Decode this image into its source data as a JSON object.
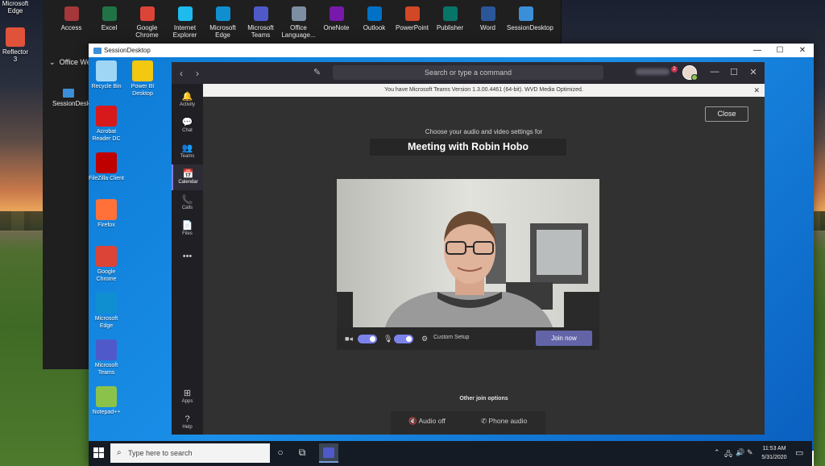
{
  "outer_desktop": {
    "icons": [
      {
        "label": "Microsoft Edge",
        "icon": "edge-icon"
      },
      {
        "label": "Reflector 3",
        "icon": "reflector-icon"
      }
    ]
  },
  "launcher": {
    "apps": [
      {
        "label": "Access",
        "icon": "access-icon",
        "color": "#a4373a"
      },
      {
        "label": "Excel",
        "icon": "excel-icon",
        "color": "#217346"
      },
      {
        "label": "Google Chrome",
        "icon": "chrome-icon",
        "color": "#db4437"
      },
      {
        "label": "Internet Explorer",
        "icon": "ie-icon",
        "color": "#1ebbee"
      },
      {
        "label": "Microsoft Edge",
        "icon": "edge-icon",
        "color": "#0f8fd0"
      },
      {
        "label": "Microsoft Teams",
        "icon": "teams-icon",
        "color": "#5059c9"
      },
      {
        "label": "Office Language...",
        "icon": "office-language-icon",
        "color": "#7d8ea3"
      },
      {
        "label": "OneNote",
        "icon": "onenote-icon",
        "color": "#7719aa"
      },
      {
        "label": "Outlook",
        "icon": "outlook-icon",
        "color": "#0072c6"
      },
      {
        "label": "PowerPoint",
        "icon": "powerpoint-icon",
        "color": "#d24726"
      },
      {
        "label": "Publisher",
        "icon": "publisher-icon",
        "color": "#077568"
      },
      {
        "label": "Word",
        "icon": "word-icon",
        "color": "#2b579a"
      },
      {
        "label": "SessionDesktop",
        "icon": "session-desktop-icon",
        "color": "#3b8fd9"
      }
    ],
    "group_label": "Office We",
    "session_label": "SessionDesktop"
  },
  "session_window": {
    "title": "SessionDesktop",
    "controls": {
      "minimize": "—",
      "maximize": "☐",
      "close": "✕"
    }
  },
  "session_desktop": {
    "icons": [
      {
        "label": "Recycle Bin",
        "icon": "recycle-bin-icon",
        "color": "#9fd6f5"
      },
      {
        "label": "Power BI Desktop",
        "icon": "power-bi-icon",
        "color": "#f2c811"
      },
      {
        "label": "Acrobat Reader DC",
        "icon": "acrobat-icon",
        "color": "#d7191c"
      },
      {
        "label": "FileZilla Client",
        "icon": "filezilla-icon",
        "color": "#bf0000"
      },
      {
        "label": "Firefox",
        "icon": "firefox-icon",
        "color": "#ff7139"
      },
      {
        "label": "Google Chrome",
        "icon": "chrome-icon",
        "color": "#db4437"
      },
      {
        "label": "Microsoft Edge",
        "icon": "edge-icon",
        "color": "#0f8fd0"
      },
      {
        "label": "Microsoft Teams",
        "icon": "teams-icon",
        "color": "#5059c9"
      },
      {
        "label": "Notepad++",
        "icon": "notepadpp-icon",
        "color": "#8bc34a"
      }
    ]
  },
  "teams": {
    "search_placeholder": "Search or type a command",
    "notification_count": "2",
    "rail": [
      {
        "label": "Activity",
        "glyph": "🔔",
        "icon": "activity-icon",
        "active": false
      },
      {
        "label": "Chat",
        "glyph": "💬",
        "icon": "chat-icon",
        "active": false
      },
      {
        "label": "Teams",
        "glyph": "👥",
        "icon": "teams-icon",
        "active": false
      },
      {
        "label": "Calendar",
        "glyph": "📅",
        "icon": "calendar-icon",
        "active": true
      },
      {
        "label": "Calls",
        "glyph": "📞",
        "icon": "calls-icon",
        "active": false
      },
      {
        "label": "Files",
        "glyph": "📄",
        "icon": "files-icon",
        "active": false
      },
      {
        "label": "",
        "glyph": "•••",
        "icon": "more-icon",
        "active": false
      },
      {
        "label": "Apps",
        "glyph": "⊞",
        "icon": "apps-icon",
        "active": false
      },
      {
        "label": "Help",
        "glyph": "?",
        "icon": "help-icon",
        "active": false
      }
    ],
    "banner": "You have Microsoft Teams Version 1.3.00.4461 (64-bit). WVD Media Optimized.",
    "prejoin": {
      "close_label": "Close",
      "choose_text": "Choose your audio and video settings for",
      "meeting_title": "Meeting with Robin Hobo",
      "camera_on": true,
      "mic_on": true,
      "custom_setup_label": "Custom Setup",
      "join_label": "Join now",
      "other_options_label": "Other join options",
      "audio_off_label": "Audio off",
      "phone_audio_label": "Phone audio"
    },
    "accent": "#6264a7"
  },
  "taskbar": {
    "search_placeholder": "Type here to search",
    "time": "11:53 AM",
    "date": "5/31/2020"
  }
}
